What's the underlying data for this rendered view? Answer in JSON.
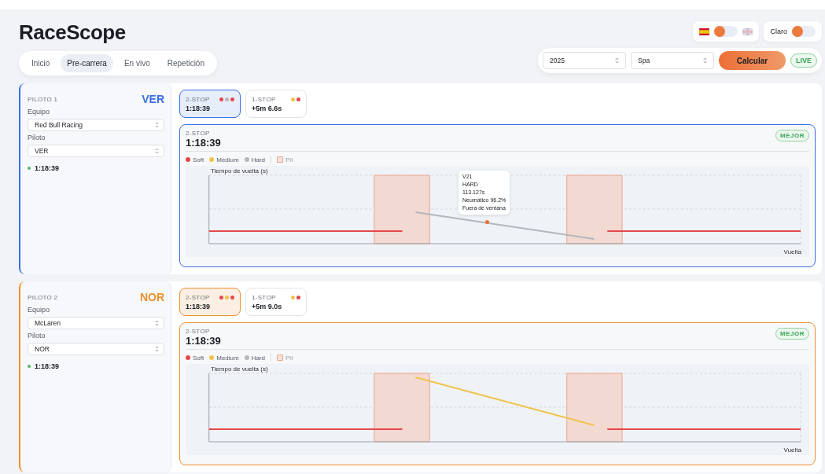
{
  "app": {
    "title": "RaceScope"
  },
  "tabs": [
    {
      "label": "Inicio",
      "selected": false
    },
    {
      "label": "Pre-carrera",
      "selected": true
    },
    {
      "label": "En vivo",
      "selected": false
    },
    {
      "label": "Repetición",
      "selected": false
    }
  ],
  "language_toggle": {
    "on": false
  },
  "theme_toggle": {
    "label": "Claro",
    "on": false
  },
  "controls": {
    "season": "2025",
    "circuit": "Spa",
    "calculate": "Calcular",
    "live": "LIVE"
  },
  "drivers": [
    {
      "heading": "PILOTO 1",
      "code": "VER",
      "color": "#3b6ee8",
      "team_label": "Equipo",
      "team": "Red Bull Racing",
      "driver_label": "Piloto",
      "driver": "VER",
      "total": "1:18:39",
      "strategies": [
        {
          "name": "2-STOP",
          "time": "1:18:39",
          "selected": true,
          "dots": [
            {
              "color": "#e5484d"
            },
            {
              "color": "#b4b7bd"
            },
            {
              "color": "#e5484d"
            }
          ]
        },
        {
          "name": "1-STOP",
          "time": "+5m 6.6s",
          "selected": false,
          "dots": [
            {
              "color": "#f0c44c"
            },
            {
              "color": "#e5484d"
            }
          ]
        }
      ],
      "detail": {
        "name": "2-STOP",
        "time": "1:18:39",
        "badge": "MEJOR",
        "legend": [
          {
            "label": "Soft",
            "color": "#e5484d"
          },
          {
            "label": "Medium",
            "color": "#f0c44c"
          },
          {
            "label": "Hard",
            "color": "#b4b7bd"
          }
        ],
        "pit": "Pit",
        "ylabel": "Tiempo de vuelta (s)",
        "xlabel": "Vuelta",
        "stints": [
          {
            "kind": "soft"
          },
          {
            "kind": "hard"
          },
          {
            "kind": "soft"
          }
        ],
        "tooltip": [
          "V21",
          "HARD",
          "113.127s",
          "Neumático 96.2%",
          "Fuera de ventana"
        ]
      }
    },
    {
      "heading": "PILOTO 2",
      "code": "NOR",
      "color": "#f0902f",
      "team_label": "Equipo",
      "team": "McLaren",
      "driver_label": "Piloto",
      "driver": "NOR",
      "total": "1:18:39",
      "strategies": [
        {
          "name": "2-STOP",
          "time": "1:18:39",
          "selected": true,
          "dots": [
            {
              "color": "#e5484d"
            },
            {
              "color": "#f0c44c"
            },
            {
              "color": "#e5484d"
            }
          ]
        },
        {
          "name": "1-STOP",
          "time": "+5m 9.0s",
          "selected": false,
          "dots": [
            {
              "color": "#f0c44c"
            },
            {
              "color": "#e5484d"
            }
          ]
        }
      ],
      "detail": {
        "name": "2-STOP",
        "time": "1:18:39",
        "badge": "MEJOR",
        "legend": [
          {
            "label": "Soft",
            "color": "#e5484d"
          },
          {
            "label": "Medium",
            "color": "#f0c44c"
          },
          {
            "label": "Hard",
            "color": "#b4b7bd"
          }
        ],
        "pit": "Pit",
        "ylabel": "Tiempo de vuelta (s)",
        "xlabel": "Vuelta",
        "stints": [
          {
            "kind": "soft"
          },
          {
            "kind": "medium"
          },
          {
            "kind": "soft"
          }
        ]
      }
    }
  ]
}
